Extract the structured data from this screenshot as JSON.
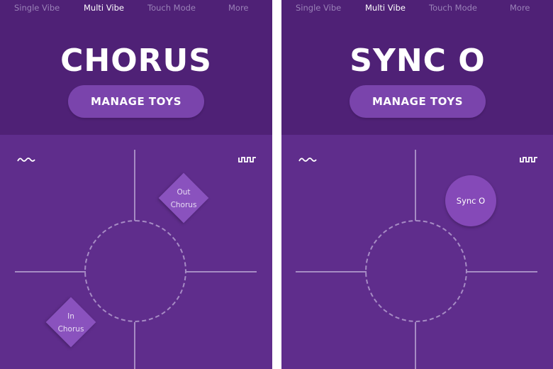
{
  "left": {
    "nav": [
      "Single Vibe",
      "Multi Vibe",
      "Touch Mode",
      "More"
    ],
    "active_nav": "Multi Vibe",
    "title": "CHORUS",
    "manage_label": "MANAGE TOYS",
    "toys": [
      {
        "line1": "Out",
        "line2": "Chorus"
      },
      {
        "line1": "In",
        "line2": "Chorus"
      }
    ]
  },
  "right": {
    "nav": [
      "Single Vibe",
      "Multi Vibe",
      "Touch Mode",
      "More"
    ],
    "active_nav": "Multi Vibe",
    "title": "SYNC O",
    "manage_label": "MANAGE TOYS",
    "toy": "Sync O"
  },
  "colors": {
    "header_bg": "#4f2176",
    "body_bg": "#5f2d8c",
    "button_bg": "#7a44ac",
    "toy_bg": "#8a52be",
    "line": "#a68bc4"
  },
  "icons": [
    "gentle-wave-icon",
    "strong-wave-icon"
  ]
}
